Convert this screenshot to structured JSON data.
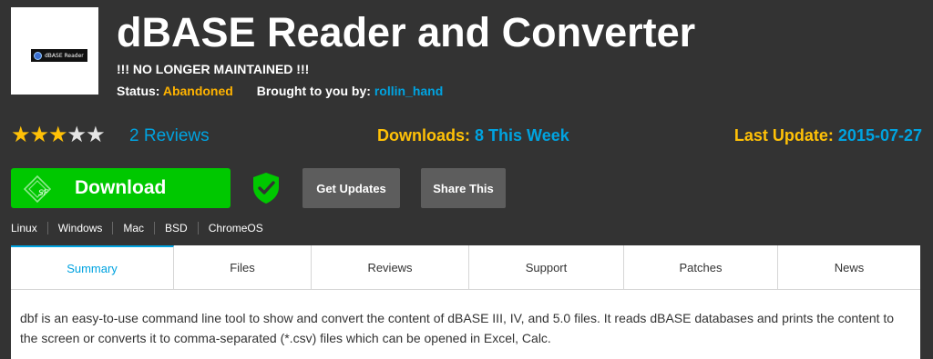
{
  "logo": {
    "text": "dBASE Reader"
  },
  "project": {
    "title": "dBASE Reader and Converter",
    "notice": "!!! NO LONGER MAINTAINED !!!",
    "status_label": "Status:",
    "status_value": "Abandoned",
    "brought_label": "Brought to you by:",
    "author": "rollin_hand"
  },
  "stats": {
    "rating": 3,
    "rating_max": 5,
    "stars": [
      {
        "glyph": "★",
        "filled": true
      },
      {
        "glyph": "★",
        "filled": true
      },
      {
        "glyph": "★",
        "filled": true
      },
      {
        "glyph": "★",
        "filled": false
      },
      {
        "glyph": "★",
        "filled": false
      }
    ],
    "reviews": "2 Reviews",
    "downloads_label": "Downloads:",
    "downloads_value": "8 This Week",
    "last_update_label": "Last Update:",
    "last_update_value": "2015-07-27"
  },
  "actions": {
    "download": "Download",
    "get_updates": "Get Updates",
    "share": "Share This",
    "download_icon": "sourceforge-icon",
    "verified_icon": "shield-check-icon"
  },
  "platforms": [
    "Linux",
    "Windows",
    "Mac",
    "BSD",
    "ChromeOS"
  ],
  "tabs": [
    {
      "label": "Summary",
      "active": true
    },
    {
      "label": "Files",
      "active": false
    },
    {
      "label": "Reviews",
      "active": false
    },
    {
      "label": "Support",
      "active": false
    },
    {
      "label": "Patches",
      "active": false
    },
    {
      "label": "News",
      "active": false
    }
  ],
  "summary": {
    "description": "dbf is an easy-to-use command line tool to show and convert the content of dBASE III, IV, and 5.0 files. It reads dBASE databases and prints the content to the screen or converts it to comma-separated (*.csv) files which can be opened in Excel, Calc."
  },
  "colors": {
    "background": "#333333",
    "accent_blue": "#00a3e0",
    "accent_orange": "#ffb300",
    "download_green": "#00c800",
    "star_gold": "#ffc107"
  }
}
